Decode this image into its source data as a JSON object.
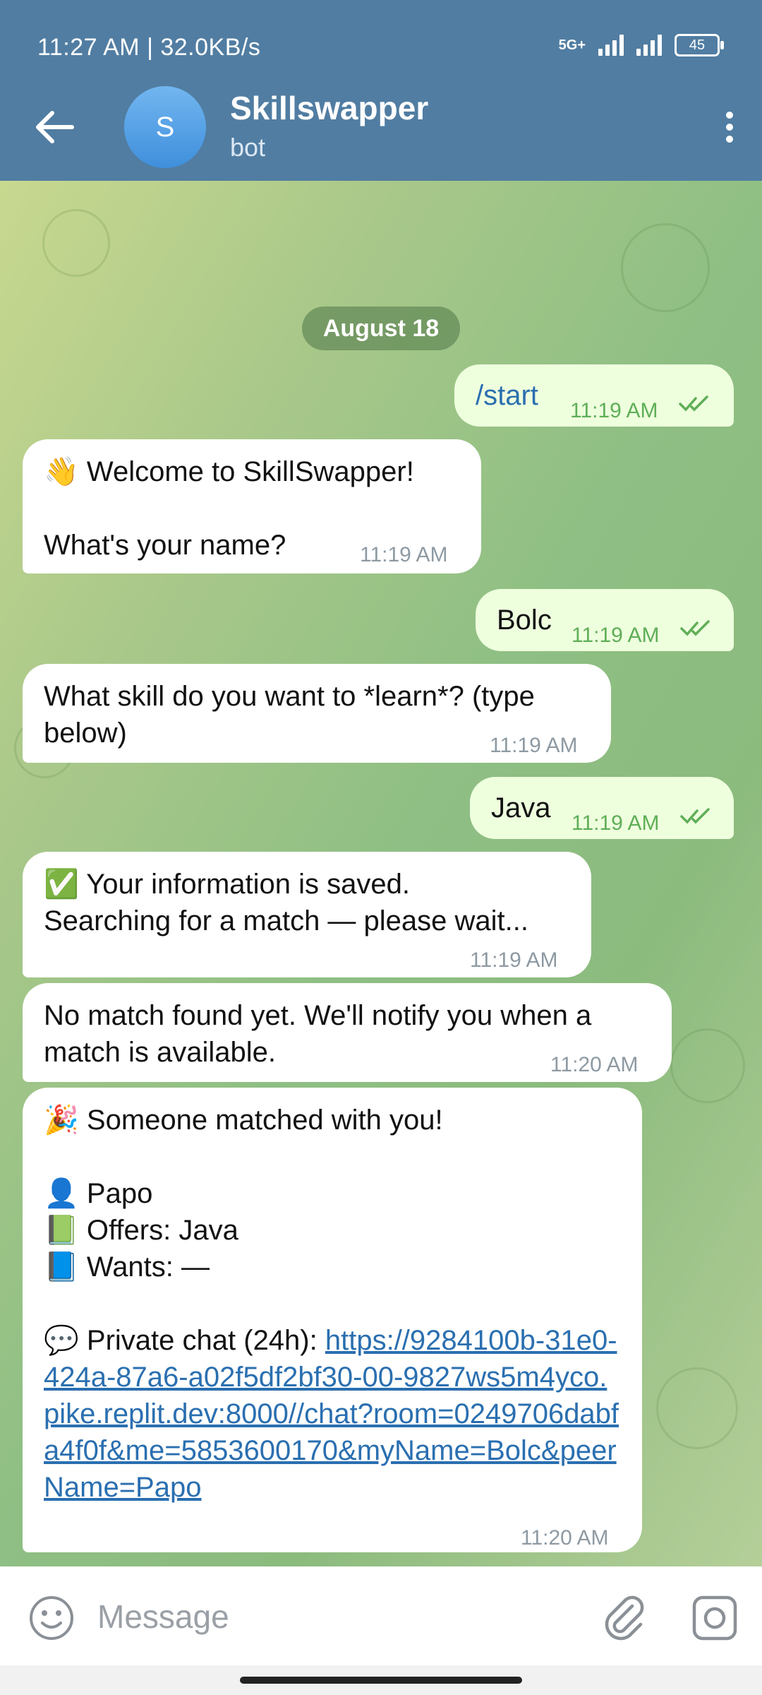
{
  "status_bar": {
    "time_speed": "11:27 AM | 32.0KB/s",
    "network": "5G+",
    "battery": "45"
  },
  "header": {
    "avatar_letter": "S",
    "title": "Skillswapper",
    "subtitle": "bot"
  },
  "chat": {
    "date": "August 18",
    "m1": {
      "text": "/start",
      "time": "11:19 AM"
    },
    "m2": {
      "line1": "👋 Welcome to SkillSwapper!",
      "line2": "What's your name?",
      "time": "11:19 AM"
    },
    "m3": {
      "text": "Bolc",
      "time": "11:19 AM"
    },
    "m4": {
      "line1": "What skill do you want to *learn*? (type",
      "line2": "below)",
      "time": "11:19 AM"
    },
    "m5": {
      "text": "Java",
      "time": "11:19 AM"
    },
    "m6": {
      "line1": "✅ Your information is saved.",
      "line2": "Searching for a match — please wait...",
      "time": "11:19 AM"
    },
    "m7": {
      "line1": "No match found yet. We'll notify you when a",
      "line2": "match is available.",
      "time": "11:20 AM"
    },
    "m8": {
      "line1": "🎉 Someone matched with you!",
      "name": "👤 Papo",
      "offers": "📗 Offers: Java",
      "wants": "📘 Wants: —",
      "private_label": "💬 Private chat (24h): ",
      "link": "https://9284100b-31e0-424a-87a6-a02f5df2bf30-00-9827ws5m4yco.pike.replit.dev:8000//chat?room=0249706dabfa4f0f&me=5853600170&myName=Bolc&peerName=Papo",
      "time": "11:20 AM"
    }
  },
  "input": {
    "placeholder": "Message"
  },
  "colors": {
    "header": "#517da2",
    "outgoing_bubble": "#eeffde",
    "incoming_bubble": "#ffffff",
    "link": "#2a6fb0"
  }
}
